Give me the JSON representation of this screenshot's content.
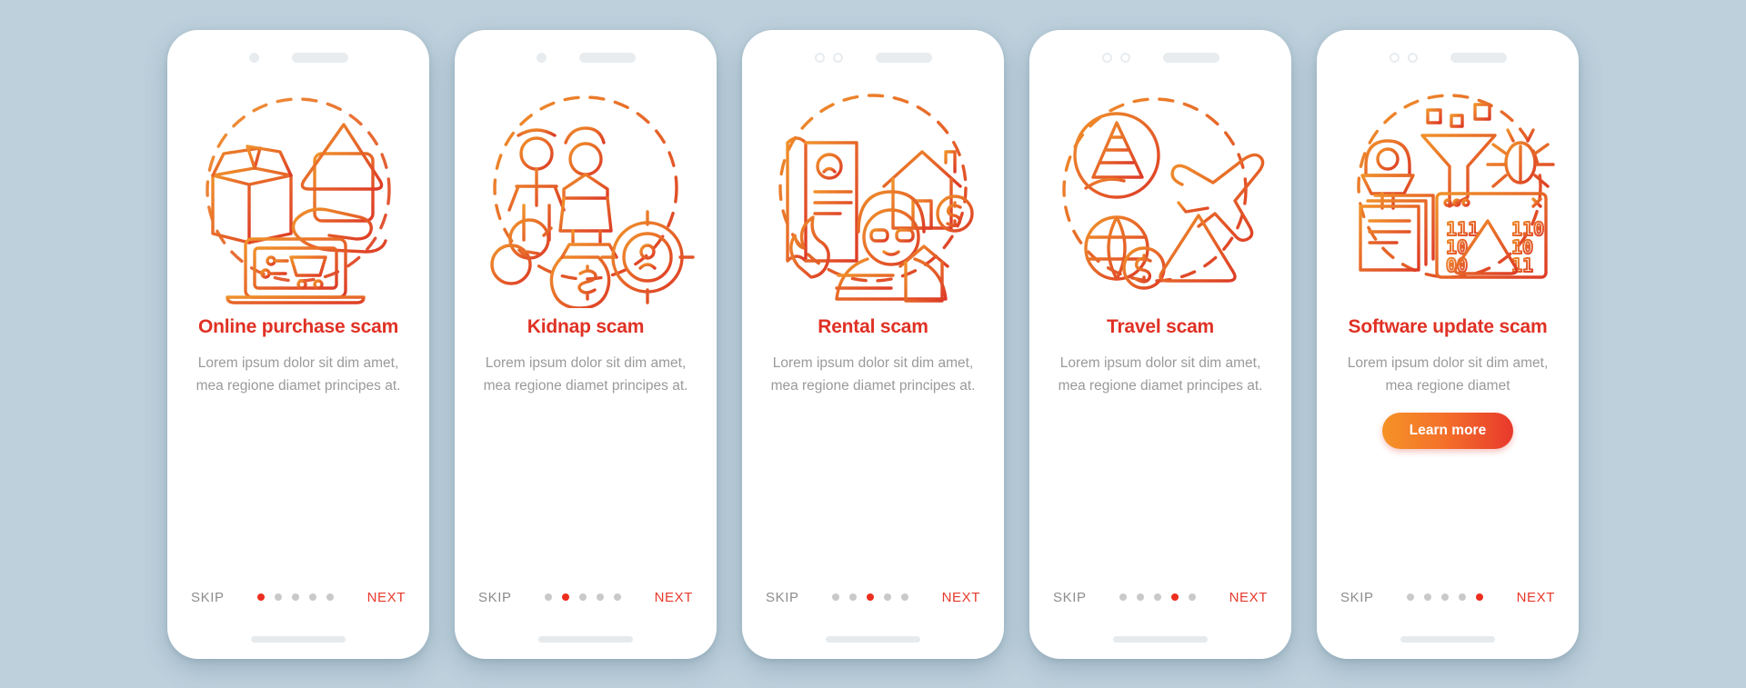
{
  "theme": {
    "background": "#bdd0dc",
    "card_background": "#ffffff",
    "title_color": "#e03124",
    "body_color": "#9a9a9a",
    "accent_red": "#ed2e1e",
    "accent_orange": "#f59226",
    "skip_color": "#8d8d8d",
    "dot_inactive": "#c9c9c9"
  },
  "common": {
    "skip_label": "SKIP",
    "next_label": "NEXT",
    "dot_count": 5
  },
  "screens": [
    {
      "title": "Online purchase scam",
      "body": "Lorem ipsum dolor sit dim amet, mea regione diamet principes at.",
      "skip_label": "SKIP",
      "next_label": "NEXT",
      "active_dot": 1,
      "notch_style": "dot-bar",
      "icon_name": "online-purchase-scam-icon",
      "has_button": false,
      "button_label": ""
    },
    {
      "title": "Kidnap scam",
      "body": "Lorem ipsum dolor sit dim amet, mea regione diamet principes at.",
      "skip_label": "SKIP",
      "next_label": "NEXT",
      "active_dot": 2,
      "notch_style": "dot-bar",
      "icon_name": "kidnap-scam-icon",
      "has_button": false,
      "button_label": ""
    },
    {
      "title": "Rental scam",
      "body": "Lorem ipsum dolor sit dim amet, mea regione diamet principes at.",
      "skip_label": "SKIP",
      "next_label": "NEXT",
      "active_dot": 3,
      "notch_style": "rings-bar",
      "icon_name": "rental-scam-icon",
      "has_button": false,
      "button_label": ""
    },
    {
      "title": "Travel scam",
      "body": "Lorem ipsum dolor sit dim amet, mea regione diamet principes at.",
      "skip_label": "SKIP",
      "next_label": "NEXT",
      "active_dot": 4,
      "notch_style": "rings-bar",
      "icon_name": "travel-scam-icon",
      "has_button": false,
      "button_label": ""
    },
    {
      "title": "Software update scam",
      "body": "Lorem ipsum dolor sit dim amet, mea regione diamet",
      "skip_label": "SKIP",
      "next_label": "NEXT",
      "active_dot": 5,
      "notch_style": "rings-bar",
      "icon_name": "software-update-scam-icon",
      "has_button": true,
      "button_label": "Learn more"
    }
  ]
}
